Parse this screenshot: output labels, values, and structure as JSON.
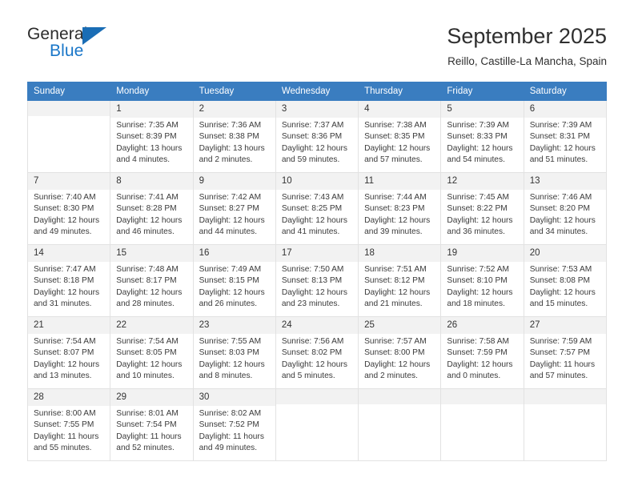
{
  "brand": {
    "name_top": "General",
    "name_bottom": "Blue",
    "triangle_color": "#1a6db5",
    "blue_color": "#1976c8"
  },
  "header": {
    "title": "September 2025",
    "subtitle": "Reillo, Castille-La Mancha, Spain"
  },
  "calendar": {
    "header_bg": "#3a7dc0",
    "weekday_headers": [
      "Sunday",
      "Monday",
      "Tuesday",
      "Wednesday",
      "Thursday",
      "Friday",
      "Saturday"
    ],
    "weeks": [
      [
        {
          "day": "",
          "empty": true,
          "sunrise": "",
          "sunset": "",
          "daylight_1": "",
          "daylight_2": ""
        },
        {
          "day": "1",
          "sunrise": "Sunrise: 7:35 AM",
          "sunset": "Sunset: 8:39 PM",
          "daylight_1": "Daylight: 13 hours",
          "daylight_2": "and 4 minutes."
        },
        {
          "day": "2",
          "sunrise": "Sunrise: 7:36 AM",
          "sunset": "Sunset: 8:38 PM",
          "daylight_1": "Daylight: 13 hours",
          "daylight_2": "and 2 minutes."
        },
        {
          "day": "3",
          "sunrise": "Sunrise: 7:37 AM",
          "sunset": "Sunset: 8:36 PM",
          "daylight_1": "Daylight: 12 hours",
          "daylight_2": "and 59 minutes."
        },
        {
          "day": "4",
          "sunrise": "Sunrise: 7:38 AM",
          "sunset": "Sunset: 8:35 PM",
          "daylight_1": "Daylight: 12 hours",
          "daylight_2": "and 57 minutes."
        },
        {
          "day": "5",
          "sunrise": "Sunrise: 7:39 AM",
          "sunset": "Sunset: 8:33 PM",
          "daylight_1": "Daylight: 12 hours",
          "daylight_2": "and 54 minutes."
        },
        {
          "day": "6",
          "sunrise": "Sunrise: 7:39 AM",
          "sunset": "Sunset: 8:31 PM",
          "daylight_1": "Daylight: 12 hours",
          "daylight_2": "and 51 minutes."
        }
      ],
      [
        {
          "day": "7",
          "sunrise": "Sunrise: 7:40 AM",
          "sunset": "Sunset: 8:30 PM",
          "daylight_1": "Daylight: 12 hours",
          "daylight_2": "and 49 minutes."
        },
        {
          "day": "8",
          "sunrise": "Sunrise: 7:41 AM",
          "sunset": "Sunset: 8:28 PM",
          "daylight_1": "Daylight: 12 hours",
          "daylight_2": "and 46 minutes."
        },
        {
          "day": "9",
          "sunrise": "Sunrise: 7:42 AM",
          "sunset": "Sunset: 8:27 PM",
          "daylight_1": "Daylight: 12 hours",
          "daylight_2": "and 44 minutes."
        },
        {
          "day": "10",
          "sunrise": "Sunrise: 7:43 AM",
          "sunset": "Sunset: 8:25 PM",
          "daylight_1": "Daylight: 12 hours",
          "daylight_2": "and 41 minutes."
        },
        {
          "day": "11",
          "sunrise": "Sunrise: 7:44 AM",
          "sunset": "Sunset: 8:23 PM",
          "daylight_1": "Daylight: 12 hours",
          "daylight_2": "and 39 minutes."
        },
        {
          "day": "12",
          "sunrise": "Sunrise: 7:45 AM",
          "sunset": "Sunset: 8:22 PM",
          "daylight_1": "Daylight: 12 hours",
          "daylight_2": "and 36 minutes."
        },
        {
          "day": "13",
          "sunrise": "Sunrise: 7:46 AM",
          "sunset": "Sunset: 8:20 PM",
          "daylight_1": "Daylight: 12 hours",
          "daylight_2": "and 34 minutes."
        }
      ],
      [
        {
          "day": "14",
          "sunrise": "Sunrise: 7:47 AM",
          "sunset": "Sunset: 8:18 PM",
          "daylight_1": "Daylight: 12 hours",
          "daylight_2": "and 31 minutes."
        },
        {
          "day": "15",
          "sunrise": "Sunrise: 7:48 AM",
          "sunset": "Sunset: 8:17 PM",
          "daylight_1": "Daylight: 12 hours",
          "daylight_2": "and 28 minutes."
        },
        {
          "day": "16",
          "sunrise": "Sunrise: 7:49 AM",
          "sunset": "Sunset: 8:15 PM",
          "daylight_1": "Daylight: 12 hours",
          "daylight_2": "and 26 minutes."
        },
        {
          "day": "17",
          "sunrise": "Sunrise: 7:50 AM",
          "sunset": "Sunset: 8:13 PM",
          "daylight_1": "Daylight: 12 hours",
          "daylight_2": "and 23 minutes."
        },
        {
          "day": "18",
          "sunrise": "Sunrise: 7:51 AM",
          "sunset": "Sunset: 8:12 PM",
          "daylight_1": "Daylight: 12 hours",
          "daylight_2": "and 21 minutes."
        },
        {
          "day": "19",
          "sunrise": "Sunrise: 7:52 AM",
          "sunset": "Sunset: 8:10 PM",
          "daylight_1": "Daylight: 12 hours",
          "daylight_2": "and 18 minutes."
        },
        {
          "day": "20",
          "sunrise": "Sunrise: 7:53 AM",
          "sunset": "Sunset: 8:08 PM",
          "daylight_1": "Daylight: 12 hours",
          "daylight_2": "and 15 minutes."
        }
      ],
      [
        {
          "day": "21",
          "sunrise": "Sunrise: 7:54 AM",
          "sunset": "Sunset: 8:07 PM",
          "daylight_1": "Daylight: 12 hours",
          "daylight_2": "and 13 minutes."
        },
        {
          "day": "22",
          "sunrise": "Sunrise: 7:54 AM",
          "sunset": "Sunset: 8:05 PM",
          "daylight_1": "Daylight: 12 hours",
          "daylight_2": "and 10 minutes."
        },
        {
          "day": "23",
          "sunrise": "Sunrise: 7:55 AM",
          "sunset": "Sunset: 8:03 PM",
          "daylight_1": "Daylight: 12 hours",
          "daylight_2": "and 8 minutes."
        },
        {
          "day": "24",
          "sunrise": "Sunrise: 7:56 AM",
          "sunset": "Sunset: 8:02 PM",
          "daylight_1": "Daylight: 12 hours",
          "daylight_2": "and 5 minutes."
        },
        {
          "day": "25",
          "sunrise": "Sunrise: 7:57 AM",
          "sunset": "Sunset: 8:00 PM",
          "daylight_1": "Daylight: 12 hours",
          "daylight_2": "and 2 minutes."
        },
        {
          "day": "26",
          "sunrise": "Sunrise: 7:58 AM",
          "sunset": "Sunset: 7:59 PM",
          "daylight_1": "Daylight: 12 hours",
          "daylight_2": "and 0 minutes."
        },
        {
          "day": "27",
          "sunrise": "Sunrise: 7:59 AM",
          "sunset": "Sunset: 7:57 PM",
          "daylight_1": "Daylight: 11 hours",
          "daylight_2": "and 57 minutes."
        }
      ],
      [
        {
          "day": "28",
          "sunrise": "Sunrise: 8:00 AM",
          "sunset": "Sunset: 7:55 PM",
          "daylight_1": "Daylight: 11 hours",
          "daylight_2": "and 55 minutes."
        },
        {
          "day": "29",
          "sunrise": "Sunrise: 8:01 AM",
          "sunset": "Sunset: 7:54 PM",
          "daylight_1": "Daylight: 11 hours",
          "daylight_2": "and 52 minutes."
        },
        {
          "day": "30",
          "sunrise": "Sunrise: 8:02 AM",
          "sunset": "Sunset: 7:52 PM",
          "daylight_1": "Daylight: 11 hours",
          "daylight_2": "and 49 minutes."
        },
        {
          "day": "",
          "empty": true,
          "sunrise": "",
          "sunset": "",
          "daylight_1": "",
          "daylight_2": ""
        },
        {
          "day": "",
          "empty": true,
          "sunrise": "",
          "sunset": "",
          "daylight_1": "",
          "daylight_2": ""
        },
        {
          "day": "",
          "empty": true,
          "sunrise": "",
          "sunset": "",
          "daylight_1": "",
          "daylight_2": ""
        },
        {
          "day": "",
          "empty": true,
          "sunrise": "",
          "sunset": "",
          "daylight_1": "",
          "daylight_2": ""
        }
      ]
    ]
  }
}
